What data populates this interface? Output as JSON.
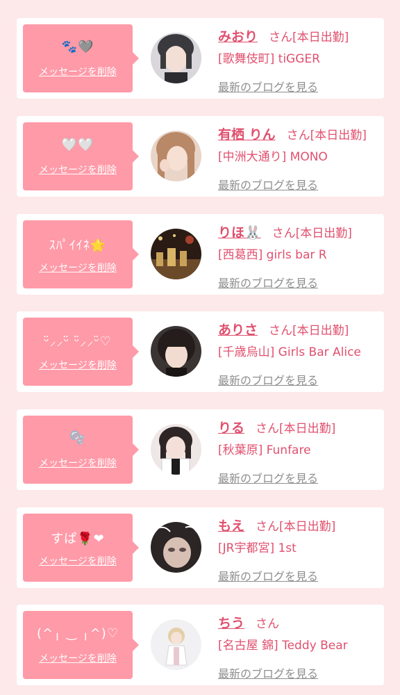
{
  "entries": [
    {
      "message": "🐾🩶",
      "delete_label": "メッセージを削除",
      "name": "みおり",
      "san": "さん",
      "status": "[本日出勤]",
      "shop": "[歌舞伎町] tiGGER",
      "blog_label": "最新のブログを見る"
    },
    {
      "message": "🤍🤍",
      "delete_label": "メッセージを削除",
      "name": "有栖 りん",
      "san": "さん",
      "status": "[本日出勤]",
      "shop": "[中洲大通り] MONO",
      "blog_label": "最新のブログを見る"
    },
    {
      "message": "ｽﾊﾟｲｲﾈ🌟",
      "delete_label": "メッセージを削除",
      "name": "りほ🐰",
      "san": "さん",
      "status": "[本日出勤]",
      "shop": "[西葛西] girls bar R",
      "blog_label": "最新のブログを見る"
    },
    {
      "message": "ᵕ̈⸝⸝ᵕ̈ ᵕ̈⸝⸝ᵕ̈♡",
      "delete_label": "メッセージを削除",
      "name": "ありさ",
      "san": "さん",
      "status": "[本日出勤]",
      "shop": "[千歳烏山] Girls Bar Alice",
      "blog_label": "最新のブログを見る"
    },
    {
      "message": "🫧",
      "delete_label": "メッセージを削除",
      "name": "りる",
      "san": "さん",
      "status": "[本日出勤]",
      "shop": "[秋葉原] Funfare",
      "blog_label": "最新のブログを見る"
    },
    {
      "message": "すぱ🌹❤",
      "delete_label": "メッセージを削除",
      "name": "もえ",
      "san": "さん",
      "status": "[本日出勤]",
      "shop": "[JR宇都宮] 1st",
      "blog_label": "最新のブログを見る"
    },
    {
      "message": "(^╷ ‿ ╷^)♡",
      "delete_label": "メッセージを削除",
      "name": "ちう",
      "san": "さん",
      "status": "",
      "shop": "[名古屋 錦] Teddy Bear",
      "blog_label": "最新のブログを見る"
    }
  ]
}
